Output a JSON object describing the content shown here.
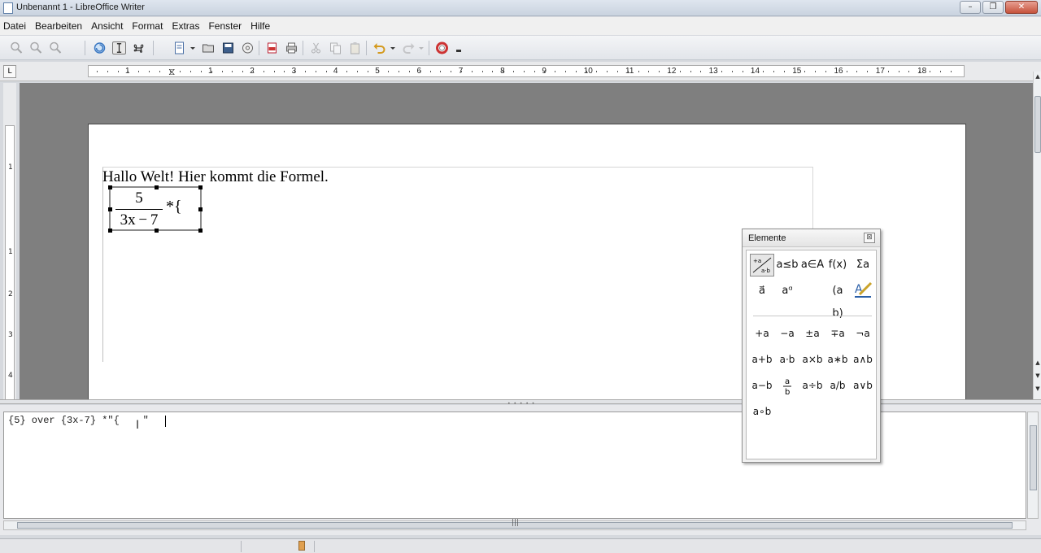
{
  "window": {
    "title": "Unbenannt 1 - LibreOffice Writer",
    "buttons": [
      "–",
      "❐",
      "✕"
    ]
  },
  "menu": [
    "Datei",
    "Bearbeiten",
    "Ansicht",
    "Format",
    "Extras",
    "Fenster",
    "Hilfe"
  ],
  "ruler": {
    "labels": [
      "1",
      "1",
      "2",
      "3",
      "4",
      "5",
      "6",
      "7",
      "8",
      "9",
      "10",
      "11",
      "12",
      "13",
      "14",
      "15",
      "16",
      "17",
      "18"
    ],
    "vertical_labels": [
      "1",
      "1",
      "2",
      "3",
      "4"
    ],
    "corner": "L"
  },
  "document": {
    "text": "Hallo Welt! Hier kommt die Formel.",
    "formula": {
      "numerator": "5",
      "denominator": "3x − 7",
      "rest": "*{"
    }
  },
  "command_editor": {
    "text": "{5} over {3x-7} *\"{    \""
  },
  "elements_panel": {
    "title": "Elemente",
    "close": "⊠",
    "categories": [
      "+a a·b",
      "a≤b",
      "a∈A",
      "f(x)",
      "Σa",
      "a⃗",
      "aᵅ",
      "(a b)",
      "🖉"
    ],
    "items": [
      "+a",
      "−a",
      "±a",
      "∓a",
      "¬a",
      "a+b",
      "a·b",
      "a×b",
      "a∗b",
      "a∧b",
      "a−b",
      "a/b",
      "a÷b",
      "a/b",
      "a∨b",
      "a∘b"
    ]
  },
  "colors": {
    "doc_background": "#7f7f7f",
    "page": "#ffffff",
    "chrome": "#f0f0f0"
  }
}
